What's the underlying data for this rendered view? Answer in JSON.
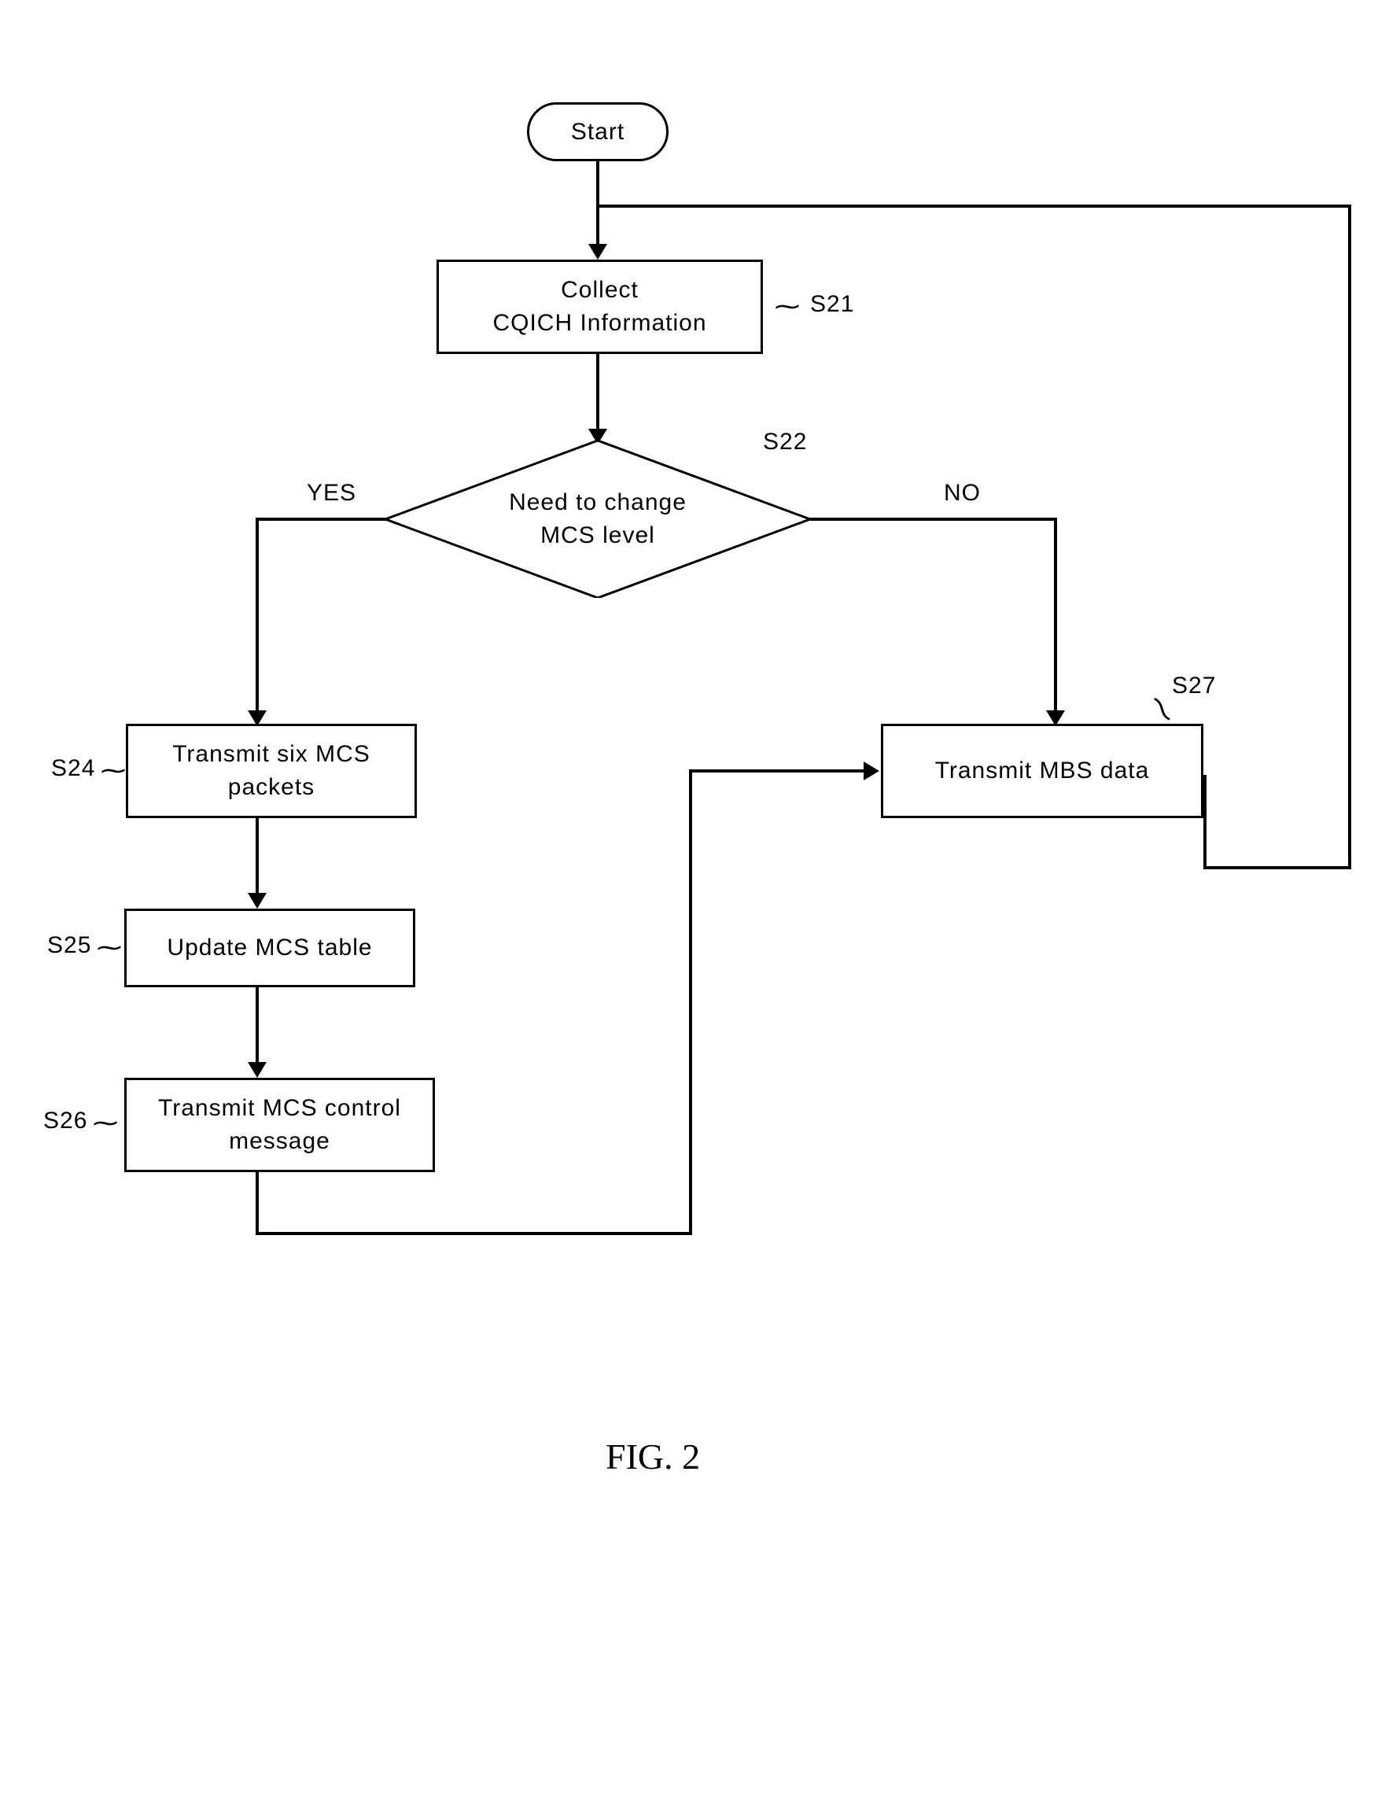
{
  "start": {
    "label": "Start"
  },
  "steps": {
    "s21": {
      "id": "S21",
      "text": "Collect\nCQICH Information"
    },
    "s22": {
      "id": "S22",
      "text": "Need to change\nMCS level"
    },
    "s24": {
      "id": "S24",
      "text": "Transmit six MCS\npackets"
    },
    "s25": {
      "id": "S25",
      "text": "Update MCS table"
    },
    "s26": {
      "id": "S26",
      "text": "Transmit MCS control\nmessage"
    },
    "s27": {
      "id": "S27",
      "text": "Transmit MBS data"
    }
  },
  "branches": {
    "yes": "YES",
    "no": "NO"
  },
  "figure": "FIG. 2",
  "chart_data": {
    "type": "flowchart",
    "nodes": [
      {
        "id": "start",
        "type": "terminal",
        "label": "Start"
      },
      {
        "id": "S21",
        "type": "process",
        "label": "Collect CQICH Information"
      },
      {
        "id": "S22",
        "type": "decision",
        "label": "Need to change MCS level"
      },
      {
        "id": "S24",
        "type": "process",
        "label": "Transmit six MCS packets"
      },
      {
        "id": "S25",
        "type": "process",
        "label": "Update MCS table"
      },
      {
        "id": "S26",
        "type": "process",
        "label": "Transmit MCS control message"
      },
      {
        "id": "S27",
        "type": "process",
        "label": "Transmit MBS data"
      }
    ],
    "edges": [
      {
        "from": "start",
        "to": "S21"
      },
      {
        "from": "S21",
        "to": "S22"
      },
      {
        "from": "S22",
        "to": "S24",
        "label": "YES"
      },
      {
        "from": "S22",
        "to": "S27",
        "label": "NO"
      },
      {
        "from": "S24",
        "to": "S25"
      },
      {
        "from": "S25",
        "to": "S26"
      },
      {
        "from": "S26",
        "to": "S27"
      },
      {
        "from": "S27",
        "to": "S21"
      }
    ]
  }
}
